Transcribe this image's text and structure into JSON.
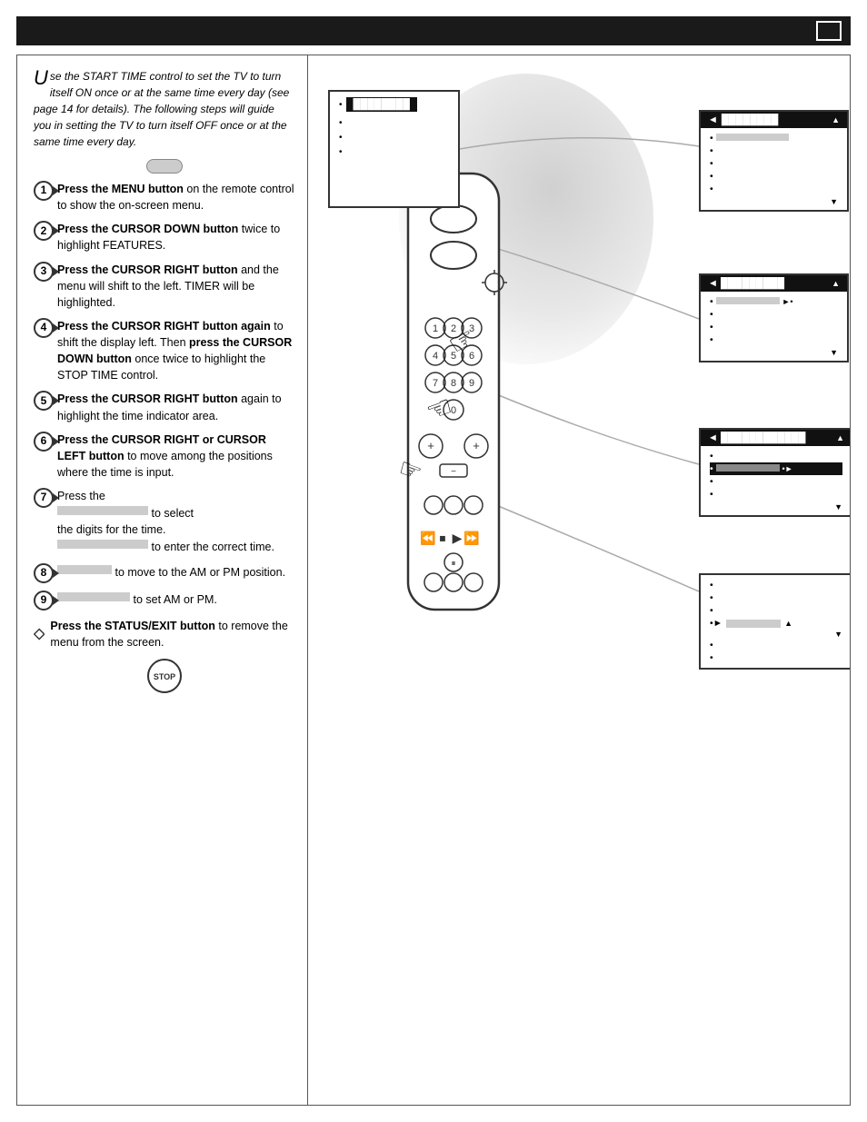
{
  "header": {
    "box_label": ""
  },
  "intro": {
    "big_letter": "U",
    "text": "se the START TIME control to set the TV to turn itself ON once or at the same time every day (see page 14 for details). The following steps will guide you in setting the TV to turn itself OFF once or at the same time every day."
  },
  "steps": [
    {
      "number": "1",
      "text": "Press the MENU button on the remote control to show the on-screen menu."
    },
    {
      "number": "2",
      "text": "Press the CURSOR DOWN button twice to highlight FEATURES."
    },
    {
      "number": "3",
      "text": "Press the CURSOR RIGHT button and the menu will shift to the left. TIMER will be highlighted."
    },
    {
      "number": "4",
      "text": "Press the CURSOR RIGHT button again to shift the display left. Then press the CURSOR DOWN button once twice to highlight the STOP TIME control."
    },
    {
      "number": "5",
      "text": "Press the CURSOR RIGHT button again to highlight the time indicator area."
    },
    {
      "number": "6",
      "text": "Press the CURSOR RIGHT or CURSOR LEFT button to move among the positions where the time is input."
    },
    {
      "number": "7",
      "text": "Press the",
      "text2": "to select the digits for the time.",
      "text3": "to enter the correct time."
    },
    {
      "number": "8",
      "text": "to move to the AM or PM position."
    },
    {
      "number": "9",
      "text": "to set AM or PM."
    }
  ],
  "final_step": {
    "text": "Press the STATUS/EXIT button to remove the menu from the screen."
  },
  "menus": {
    "menu1": {
      "items": [
        "•",
        "•",
        "•",
        "•"
      ],
      "highlighted": "•  ████████"
    },
    "menu2": {
      "title": "████████",
      "items": [
        "•",
        "•",
        "•",
        "•",
        "•"
      ]
    },
    "menu3": {
      "title": "█████████",
      "items": [
        "•",
        "•",
        "•",
        "•",
        "•"
      ]
    },
    "menu4": {
      "title": "████████████",
      "items": [
        "•",
        "•",
        "•",
        "•"
      ]
    },
    "menu5": {
      "title": "",
      "items": [
        "•",
        "•",
        "•",
        "•",
        "•"
      ]
    }
  },
  "stop_label": "STOP"
}
